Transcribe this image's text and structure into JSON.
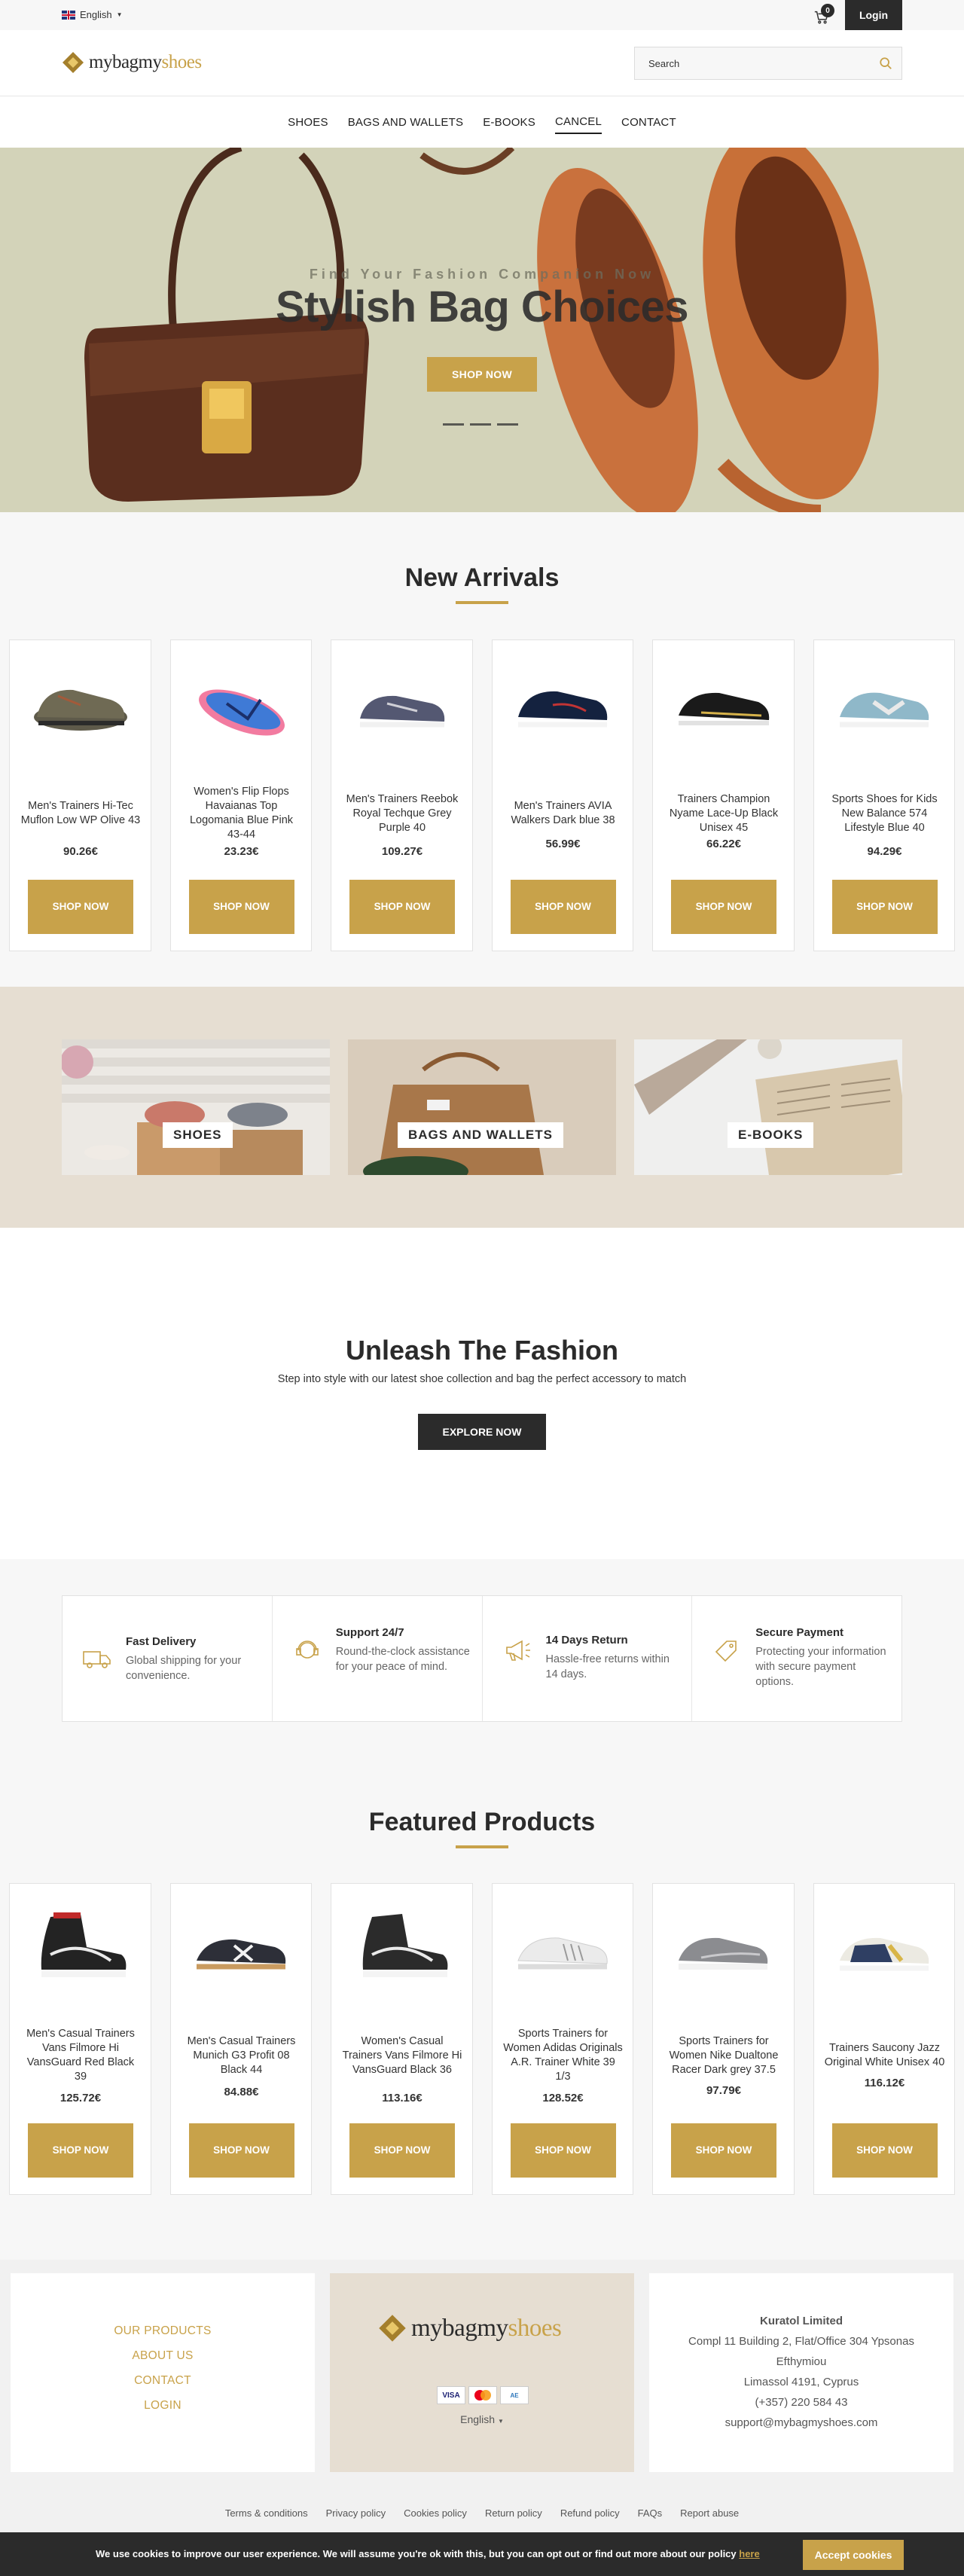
{
  "topbar": {
    "language": "English",
    "cart_count": "0",
    "login_label": "Login"
  },
  "header": {
    "logo_text_1": "mybagmy",
    "logo_text_2": "shoes",
    "search_placeholder": "Search"
  },
  "nav": {
    "items": [
      {
        "label": "SHOES"
      },
      {
        "label": "BAGS AND WALLETS"
      },
      {
        "label": "E-BOOKS"
      },
      {
        "label": "CANCEL"
      },
      {
        "label": "CONTACT"
      }
    ],
    "active": "CANCEL"
  },
  "hero": {
    "subtitle": "Find Your Fashion Companion Now",
    "title": "Stylish Bag Choices",
    "button": "SHOP NOW",
    "slides": 3
  },
  "new_arrivals": {
    "title": "New Arrivals",
    "products": [
      {
        "name": "Men's Trainers Hi-Tec Muflon Low WP Olive 43",
        "price": "90.26€",
        "button": "SHOP NOW",
        "icon": "shoe-olive-hiker"
      },
      {
        "name": "Women's Flip Flops Havaianas Top Logomania Blue Pink 43-44",
        "price": "23.23€",
        "button": "SHOP NOW",
        "icon": "flip-flop-pink"
      },
      {
        "name": "Men's Trainers Reebok Royal Techque Grey Purple 40",
        "price": "109.27€",
        "button": "SHOP NOW",
        "icon": "shoe-grey-purple"
      },
      {
        "name": "Men's Trainers AVIA Walkers Dark blue 38",
        "price": "56.99€",
        "button": "SHOP NOW",
        "icon": "shoe-dark-blue"
      },
      {
        "name": "Trainers Champion Nyame Lace-Up Black Unisex 45",
        "price": "66.22€",
        "button": "SHOP NOW",
        "icon": "shoe-black"
      },
      {
        "name": "Sports Shoes for Kids New Balance 574 Lifestyle Blue 40",
        "price": "94.29€",
        "button": "SHOP NOW",
        "icon": "shoe-light-blue"
      }
    ]
  },
  "categories": [
    {
      "label": "SHOES"
    },
    {
      "label": "BAGS AND WALLETS"
    },
    {
      "label": "E-BOOKS"
    }
  ],
  "unleash": {
    "title": "Unleash The Fashion",
    "text": "Step into style with our latest shoe collection and bag the perfect accessory to match",
    "button": "EXPLORE NOW"
  },
  "features": [
    {
      "title": "Fast Delivery",
      "desc": "Global shipping for your convenience.",
      "icon": "truck-icon"
    },
    {
      "title": "Support 24/7",
      "desc": "Round-the-clock assistance for your peace of mind.",
      "icon": "support-icon"
    },
    {
      "title": "14 Days Return",
      "desc": "Hassle-free returns within 14 days.",
      "icon": "megaphone-icon"
    },
    {
      "title": "Secure Payment",
      "desc": "Protecting your information with secure payment options.",
      "icon": "tag-icon"
    }
  ],
  "featured": {
    "title": "Featured Products",
    "products": [
      {
        "name": "Men's Casual Trainers Vans Filmore Hi VansGuard Red Black 39",
        "price": "125.72€",
        "button": "SHOP NOW",
        "icon": "hightop-black-red"
      },
      {
        "name": "Men's Casual Trainers Munich G3 Profit 08 Black 44",
        "price": "84.88€",
        "button": "SHOP NOW",
        "icon": "shoe-munich-black"
      },
      {
        "name": "Women's Casual Trainers Vans Filmore Hi VansGuard Black 36",
        "price": "113.16€",
        "button": "SHOP NOW",
        "icon": "hightop-black"
      },
      {
        "name": "Sports Trainers for Women Adidas Originals A.R. Trainer White 39 1/3",
        "price": "128.52€",
        "button": "SHOP NOW",
        "icon": "shoe-white"
      },
      {
        "name": "Sports Trainers for Women Nike Dualtone Racer Dark grey 37.5",
        "price": "97.79€",
        "button": "SHOP NOW",
        "icon": "shoe-grey"
      },
      {
        "name": "Trainers Saucony Jazz Original White Unisex 40",
        "price": "116.12€",
        "button": "SHOP NOW",
        "icon": "shoe-saucony"
      }
    ]
  },
  "footer": {
    "links": [
      "OUR PRODUCTS",
      "ABOUT US",
      "CONTACT",
      "LOGIN"
    ],
    "payments": [
      "VISA",
      "MC",
      "AE"
    ],
    "language": "English",
    "company": "Kuratol Limited",
    "address_1": "Compl 11 Building 2, Flat/Office 304 Ypsonas",
    "address_2": "Efthymiou",
    "address_3": "Limassol 4191, Cyprus",
    "phone": "(+357) 220 584 43",
    "email": "support@mybagmyshoes.com",
    "legal": [
      "Terms & conditions",
      "Privacy policy",
      "Cookies policy",
      "Return policy",
      "Refund policy",
      "FAQs",
      "Report abuse"
    ]
  },
  "cookie": {
    "text": "We use cookies to improve our user experience. We will assume you're ok with this, but you can opt out or find out more about our policy ",
    "link": "here",
    "button": "Accept cookies"
  },
  "colors": {
    "accent": "#c8a24a",
    "dark": "#2b2b2b",
    "beige": "#e6ded2"
  }
}
